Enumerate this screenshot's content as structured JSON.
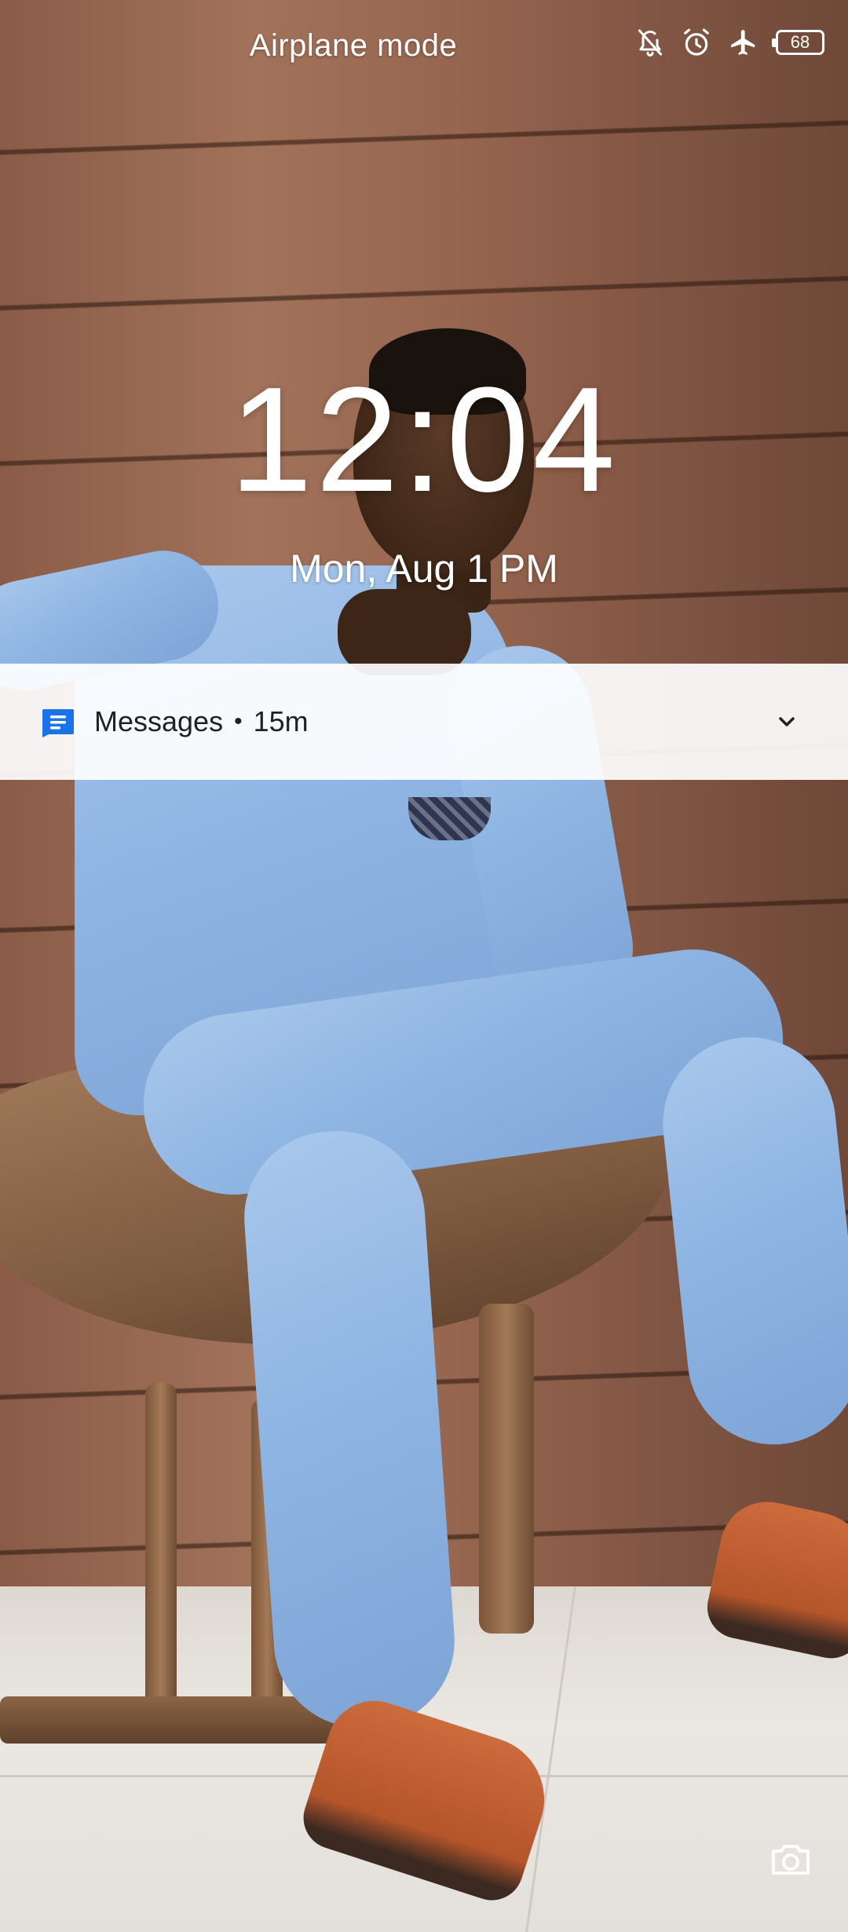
{
  "status_bar": {
    "title": "Airplane mode",
    "icons": [
      "notifications-off-icon",
      "alarm-icon",
      "airplane-icon",
      "battery-icon"
    ],
    "battery_level": "68"
  },
  "lock_screen": {
    "time": "12:04",
    "date": "Mon, Aug 1 PM"
  },
  "notification": {
    "icon": "messages-icon",
    "app_name": "Messages",
    "separator": "•",
    "time_ago": "15m",
    "expand_icon": "chevron-down-icon"
  },
  "shortcuts": {
    "camera_icon": "camera-icon"
  },
  "colors": {
    "messages_accent": "#1a73e8",
    "text_light": "#ffffff",
    "text_dark": "#202124"
  }
}
